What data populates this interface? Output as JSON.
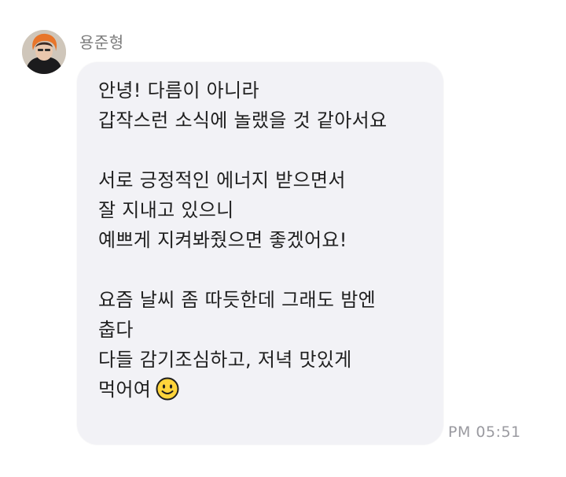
{
  "sender": {
    "name": "용준형"
  },
  "message": {
    "paragraph1": {
      "line1": "안녕! 다름이 아니라",
      "line2": "갑작스런 소식에 놀랬을 것 같아서요"
    },
    "paragraph2": {
      "line1": "서로 긍정적인 에너지 받으면서",
      "line2": "잘 지내고 있으니",
      "line3": "예쁘게 지켜봐줬으면 좋겠어요!"
    },
    "paragraph3": {
      "line1": "요즘 날씨 좀 따듯한데 그래도 밤엔",
      "line2": "춥다",
      "line3": "다들 감기조심하고, 저녁 맛있게",
      "line4": "먹어여"
    },
    "emoji": "smiling-face-icon"
  },
  "timestamp": "PM 05:51",
  "colors": {
    "bubble_background": "#f2f2f6",
    "text": "#1f1f1f",
    "sender_name": "#7c7c7c",
    "timestamp": "#9a9aa0",
    "emoji_face": "#ffd43b"
  }
}
